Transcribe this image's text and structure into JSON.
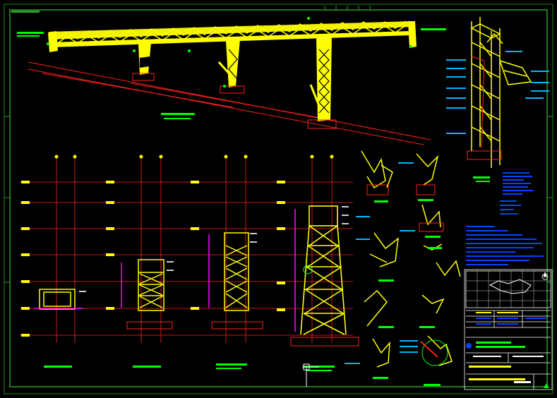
{
  "drawing": {
    "background": "#000000",
    "colors": {
      "frame": "#2e9e2e",
      "truss": "#ffff00",
      "gridline": "#ff2020",
      "label": "#00ff00",
      "note": "#00b8ff",
      "title_block": "#ffffff",
      "dimension": "#ff00ff",
      "accent": "#ff8800"
    },
    "icons": [
      "ucs-axis-icon",
      "north-arrow-icon"
    ]
  }
}
